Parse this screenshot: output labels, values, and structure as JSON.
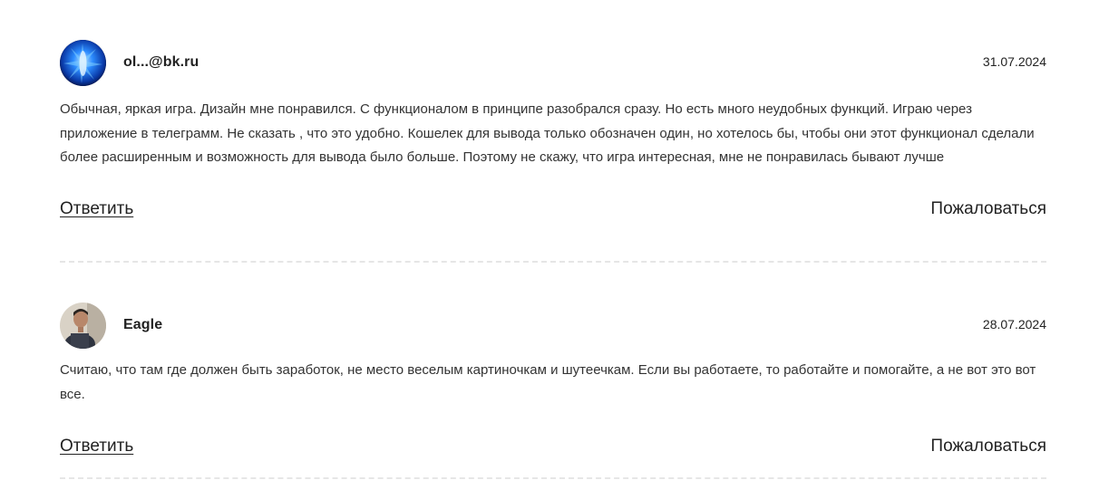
{
  "comments": [
    {
      "author": "ol...@bk.ru",
      "date": "31.07.2024",
      "avatar_icon": "blue-abstract-avatar-icon",
      "text": "Обычная, яркая игра. Дизайн мне понравился. С функционалом в принципе разобрался сразу. Но есть много неудобных функций. Играю через приложение в телеграмм. Не сказать , что это удобно. Кошелек для вывода только обозначен один, но хотелось бы, чтобы они этот функционал сделали более расширенным и возможность для вывода было больше. Поэтому не скажу, что игра интересная, мне не понравилась бывают лучше",
      "reply_label": "Ответить",
      "report_label": "Пожаловаться"
    },
    {
      "author": "Eagle",
      "date": "28.07.2024",
      "avatar_icon": "person-photo-avatar-icon",
      "text": "Считаю, что там где должен быть заработок, не место веселым картиночкам и шутеечкам. Если вы работаете, то работайте и помогайте, а не вот это вот все.",
      "reply_label": "Ответить",
      "report_label": "Пожаловаться"
    }
  ],
  "colors": {
    "text": "#222222",
    "body_text": "#333333",
    "divider": "#e6e6e6",
    "avatar1_primary": "#1565d8"
  }
}
